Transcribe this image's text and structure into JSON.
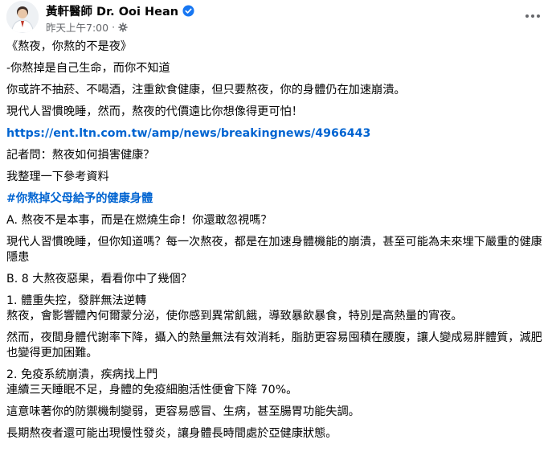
{
  "post": {
    "author": "黃軒醫師 Dr. Ooi Hean",
    "timestamp": "昨天上午7:00",
    "lines": [
      "《熬夜，你熬的不是夜》",
      "-你熬掉是自己生命，而你不知道",
      "你或許不抽菸、不喝酒，注重飲食健康，但只要熬夜，你的身體仍在加速崩潰。",
      "現代人習慣晚睡，然而，熬夜的代價遠比你想像得更可怕！",
      "https://ent.ltn.com.tw/amp/news/breakingnews/4966443",
      "記者問：熬夜如何損害健康？",
      "我整理一下參考資料",
      "#你熬掉父母給予的健康身體",
      "A. 熬夜不是本事，而是在燃燒生命！你還敢忽視嗎？",
      "現代人習慣晚睡，但你知道嗎？每一次熬夜，都是在加速身體機能的崩潰，甚至可能為未來埋下嚴重的健康隱患",
      "B.  8 大熬夜惡果，看看你中了幾個？",
      "1. 體重失控，發胖無法逆轉\n熬夜，會影響體內何爾蒙分泌，使你感到異常飢餓，導致暴飲暴食，特別是高熱量的宵夜。",
      "然而，夜間身體代謝率下降，攝入的熱量無法有效消耗，脂肪更容易囤積在腰腹，讓人變成易胖體質，減肥也變得更加困難。",
      "2. 免疫系統崩潰，疾病找上門\n連續三天睡眠不足，身體的免疫細胞活性便會下降 70%。",
      "這意味著你的防禦機制變弱，更容易感冒、生病，甚至腸胃功能失調。",
      "長期熬夜者還可能出現慢性發炎，讓身體長時間處於亞健康狀態。"
    ]
  },
  "icons": {
    "verified": "verified-badge-icon",
    "privacy": "gear-icon",
    "more": "more-options-icon"
  },
  "colors": {
    "link": "#0064d1",
    "meta": "#65676b",
    "verified": "#1877f2"
  }
}
